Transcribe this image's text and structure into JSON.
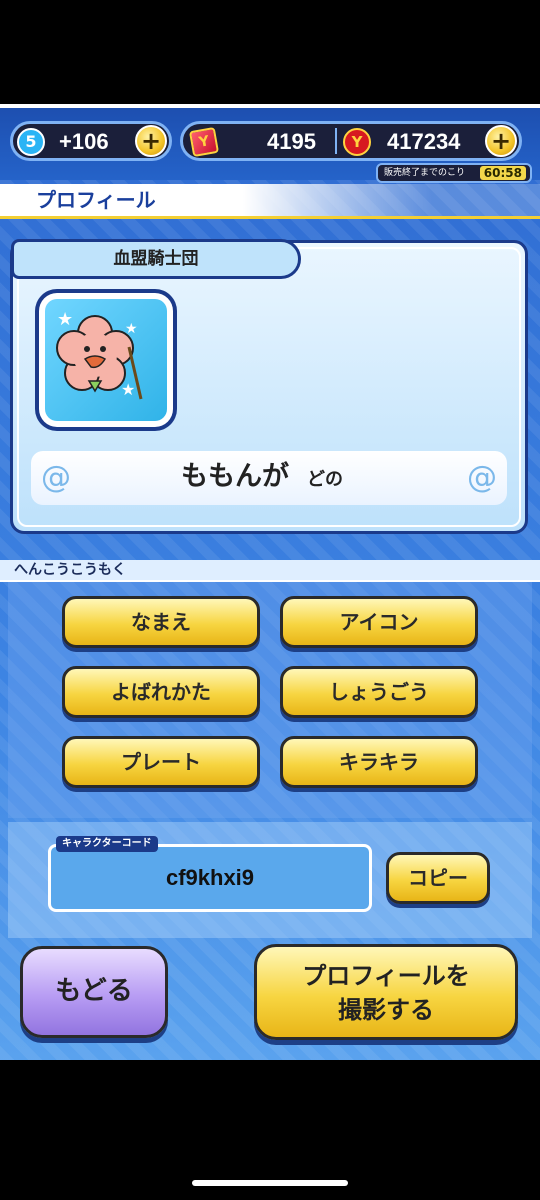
{
  "hud": {
    "level": "5",
    "stamina": "+106",
    "plus": "+",
    "gems": "4195",
    "coins": "417234",
    "sale_label": "販売終了までのこり",
    "sale_time": "60:58"
  },
  "header": {
    "title": "プロフィール"
  },
  "profile": {
    "guild": "血盟騎士団",
    "avatar_icon": "cherry-blossom-character-icon",
    "name": "ももんが",
    "suffix": "どの"
  },
  "edit": {
    "section_label": "へんこうこうもく",
    "buttons": [
      "なまえ",
      "アイコン",
      "よばれかた",
      "しょうごう",
      "プレート",
      "キラキラ"
    ]
  },
  "code": {
    "tag": "キャラクターコード",
    "value": "cf9khxi9",
    "copy_label": "コピー"
  },
  "footer": {
    "back_label": "もどる",
    "photo_label_line1": "プロフィールを",
    "photo_label_line2": "撮影する"
  },
  "colors": {
    "accent_yellow": "#f7d541",
    "panel_blue": "#3d84e3",
    "border_navy": "#1b3a8a",
    "back_purple": "#b79cf3"
  }
}
